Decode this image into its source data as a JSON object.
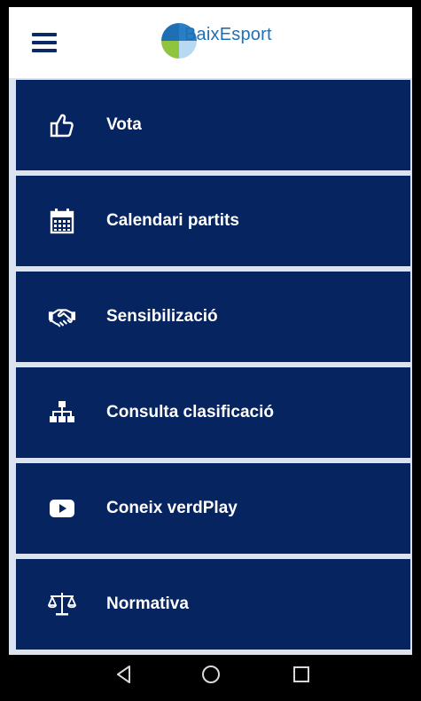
{
  "header": {
    "menu_icon": "hamburger-menu-icon",
    "logo_text": "BaixEsport",
    "logo_colors": [
      "#1f6fb5",
      "#8fc43f",
      "#b8d9f2"
    ],
    "brand_color": "#0a2a66"
  },
  "menu": {
    "items": [
      {
        "label": "Vota",
        "icon": "thumbs-up-icon"
      },
      {
        "label": "Calendari partits",
        "icon": "calendar-icon"
      },
      {
        "label": "Sensibilizació",
        "icon": "handshake-icon"
      },
      {
        "label": "Consulta clasificació",
        "icon": "sitemap-icon"
      },
      {
        "label": "Coneix verdPlay",
        "icon": "youtube-icon"
      },
      {
        "label": "Normativa",
        "icon": "balance-scale-icon"
      }
    ],
    "item_color": "#062460",
    "text_color": "#ffffff"
  },
  "navbar": {
    "buttons": [
      "back-icon",
      "home-icon",
      "recents-icon"
    ]
  }
}
